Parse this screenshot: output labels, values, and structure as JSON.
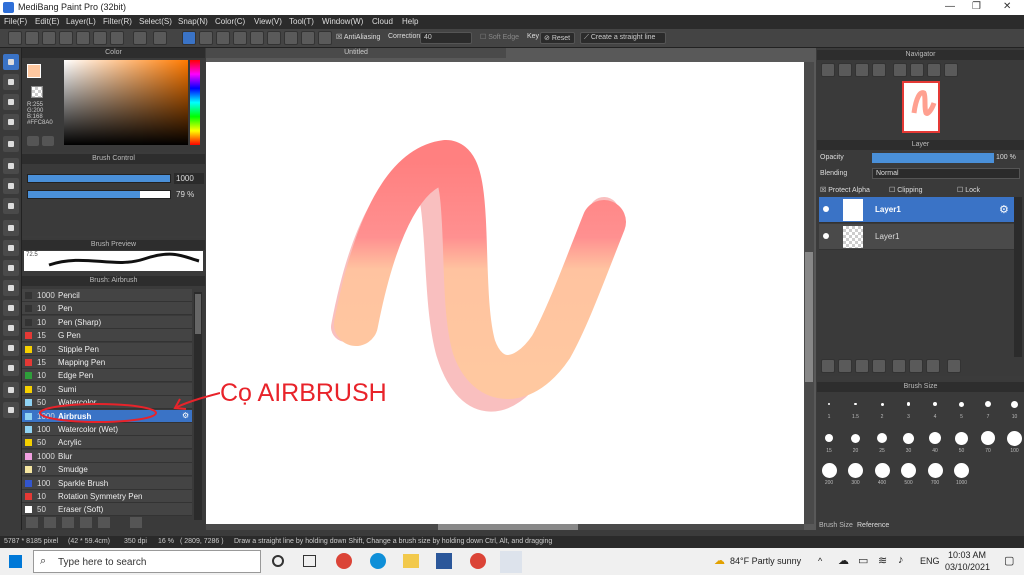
{
  "window": {
    "title": "MediBang Paint Pro (32bit)"
  },
  "menu": [
    "File(F)",
    "Edit(E)",
    "Layer(L)",
    "Filter(R)",
    "Select(S)",
    "Snap(N)",
    "Color(C)",
    "View(V)",
    "Tool(T)",
    "Window(W)",
    "Cloud",
    "Help"
  ],
  "toolbar": {
    "antialiasing": "AntiAliasing",
    "correction_label": "Correction",
    "correction_value": "40",
    "soft_edge": "Soft Edge",
    "key": "Key",
    "reset": "Reset",
    "straight_line": "Create a straight line"
  },
  "color_panel": {
    "title": "Color",
    "rgb": [
      "R:255",
      "G:200",
      "B:168"
    ],
    "hex": "#FFC8A0",
    "primary": "#FFC8A0"
  },
  "brush_control": {
    "title": "Brush Control",
    "size": "1000",
    "opacity": "79 %",
    "size_frac": 1.0,
    "opacity_frac": 0.79
  },
  "brush_preview": {
    "title": "Brush Preview",
    "value": "72.5"
  },
  "brush_list": {
    "title": "Brush: Airbrush",
    "items": [
      {
        "size": "1000",
        "name": "Pencil",
        "color": "#333333"
      },
      {
        "size": "10",
        "name": "Pen",
        "color": "#333333"
      },
      {
        "size": "10",
        "name": "Pen (Sharp)",
        "color": "#333333"
      },
      {
        "size": "15",
        "name": "G Pen",
        "color": "#e53935"
      },
      {
        "size": "50",
        "name": "Stipple Pen",
        "color": "#f5d000"
      },
      {
        "size": "15",
        "name": "Mapping Pen",
        "color": "#e53935"
      },
      {
        "size": "10",
        "name": "Edge Pen",
        "color": "#2e9e3a"
      },
      {
        "size": "50",
        "name": "Sumi",
        "color": "#f5d000"
      },
      {
        "size": "50",
        "name": "Watercolor",
        "color": "#8fd3f4"
      },
      {
        "size": "1000",
        "name": "Airbrush",
        "color": "#8fd3f4"
      },
      {
        "size": "100",
        "name": "Watercolor (Wet)",
        "color": "#8fd3f4"
      },
      {
        "size": "50",
        "name": "Acrylic",
        "color": "#f5d000"
      },
      {
        "size": "1000",
        "name": "Blur",
        "color": "#f0a0e0"
      },
      {
        "size": "70",
        "name": "Smudge",
        "color": "#f5e6a0"
      },
      {
        "size": "100",
        "name": "Sparkle Brush",
        "color": "#3355cc"
      },
      {
        "size": "10",
        "name": "Rotation Symmetry Pen",
        "color": "#e53935"
      },
      {
        "size": "50",
        "name": "Eraser (Soft)",
        "color": "#ffffff"
      }
    ],
    "selected_index": 9
  },
  "canvas": {
    "tab": "Untitled"
  },
  "annotation": "Cọ AIRBRUSH",
  "navigator": {
    "title": "Navigator"
  },
  "layer_panel": {
    "title": "Layer",
    "opacity_label": "Opacity",
    "opacity_value": "100 %",
    "opacity_frac": 1.0,
    "blending_label": "Blending",
    "blending_value": "Normal",
    "protect_alpha": "Protect Alpha",
    "clipping": "Clipping",
    "lock": "Lock",
    "layers": [
      "Layer1",
      "Layer1"
    ]
  },
  "brush_size": {
    "title": "Brush Size",
    "sizes": [
      "1",
      "1.5",
      "2",
      "3",
      "4",
      "5",
      "7",
      "10",
      "15",
      "20",
      "25",
      "30",
      "40",
      "50",
      "70",
      "100",
      "200",
      "300",
      "400",
      "500",
      "700",
      "1000"
    ],
    "tabs": [
      "Brush Size",
      "Reference"
    ]
  },
  "status": {
    "dims": "5787 * 8185 pixel",
    "cm": "(42 * 59.4cm)",
    "dpi": "350 dpi",
    "zoom": "16 %",
    "coords": "( 2809, 7286 )",
    "hint": "Draw a straight line by holding down Shift, Change a brush size by holding down Ctrl, Alt, and dragging"
  },
  "taskbar": {
    "search": "Type here to search",
    "weather": "84°F  Partly sunny",
    "lang": "ENG",
    "time": "10:03 AM",
    "date": "03/10/2021"
  }
}
